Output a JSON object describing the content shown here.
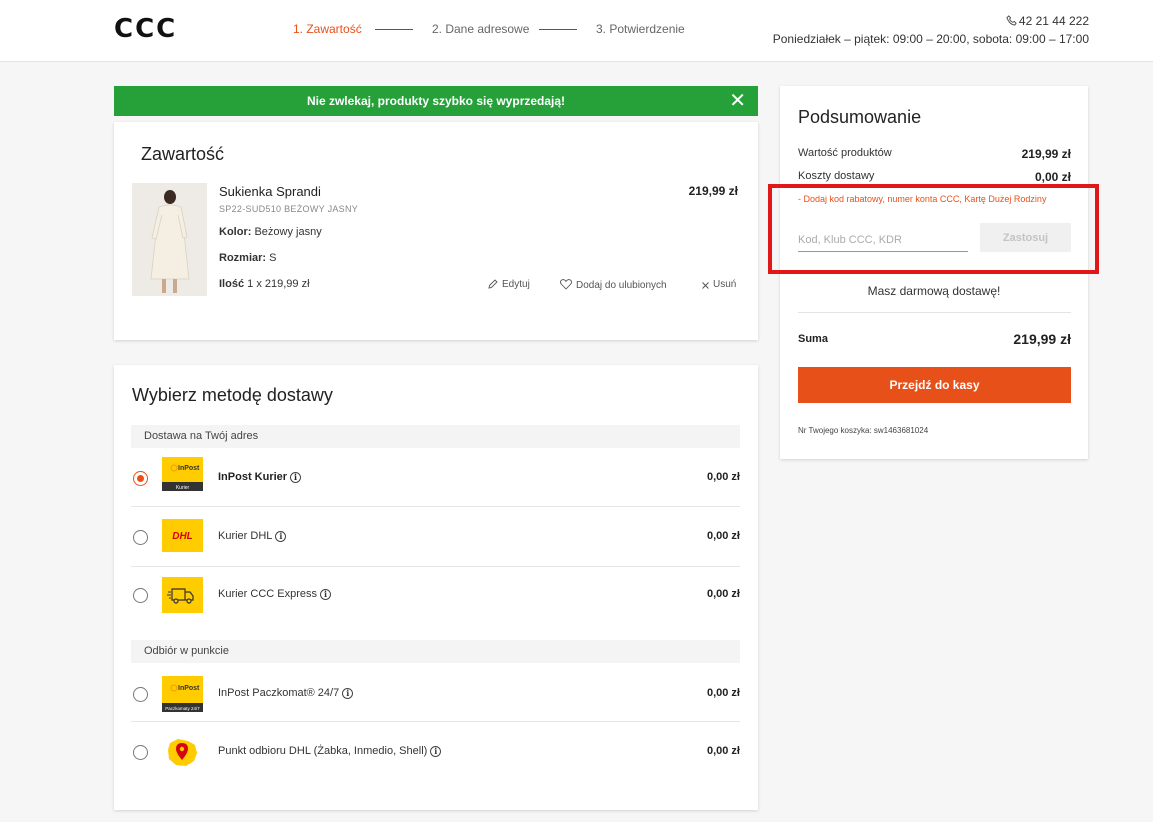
{
  "header": {
    "logo": "CCC",
    "steps": [
      {
        "label": "1. Zawartość",
        "active": true
      },
      {
        "label": "2. Dane adresowe",
        "active": false
      },
      {
        "label": "3. Potwierdzenie",
        "active": false
      }
    ],
    "phone": "42 21 44 222",
    "hours": "Poniedziałek – piątek: 09:00 – 20:00, sobota: 09:00 – 17:00"
  },
  "banner": {
    "text": "Nie zwlekaj, produkty szybko się wyprzedają!",
    "close": "✕",
    "color": "#26a13a"
  },
  "cart": {
    "title": "Zawartość",
    "product": {
      "name": "Sukienka Sprandi",
      "sku": "SP22-SUD510 BEŻOWY JASNY",
      "color_label": "Kolor:",
      "color_value": "Beżowy jasny",
      "size_label": "Rozmiar:",
      "size_value": "S",
      "qty_label": "Ilość",
      "qty_value": "1 x 219,99 zł",
      "price": "219,99 zł"
    },
    "actions": {
      "edit": "Edytuj",
      "favorite": "Dodaj do ulubionych",
      "remove": "Usuń"
    }
  },
  "delivery": {
    "title": "Wybierz metodę dostawy",
    "sections": [
      {
        "label": "Dostawa na Twój adres",
        "options": [
          {
            "name": "InPost Kurier",
            "price": "0,00 zł",
            "logo_text": "InPost",
            "logo_sub": "Kurier",
            "selected": true
          },
          {
            "name": "Kurier DHL",
            "price": "0,00 zł",
            "logo_text": "DHL",
            "selected": false
          },
          {
            "name": "Kurier CCC Express",
            "price": "0,00 zł",
            "logo_icon": "truck-icon",
            "selected": false
          }
        ]
      },
      {
        "label": "Odbiór w punkcie",
        "options": [
          {
            "name": "InPost Paczkomat® 24/7",
            "price": "0,00 zł",
            "logo_text": "InPost",
            "logo_sub": "Paczkomaty 24/7",
            "selected": false
          },
          {
            "name": "Punkt odbioru DHL (Żabka, Inmedio, Shell)",
            "price": "0,00 zł",
            "logo_icon": "map-pin-icon",
            "selected": false
          }
        ]
      }
    ]
  },
  "summary": {
    "title": "Podsumowanie",
    "products_label": "Wartość produktów",
    "products_value": "219,99 zł",
    "shipping_label": "Koszty dostawy",
    "shipping_value": "0,00 zł",
    "promo_hint": "- Dodaj kod rabatowy, numer konta CCC, Kartę Dużej Rodziny",
    "promo_placeholder": "Kod, Klub CCC, KDR",
    "apply_label": "Zastosuj",
    "free_shipping": "Masz darmową dostawę!",
    "total_label": "Suma",
    "total_value": "219,99 zł",
    "checkout_label": "Przejdź do kasy",
    "cart_number": "Nr Twojego koszyka: sw1463681024"
  },
  "colors": {
    "accent": "#e8501a",
    "highlight": "#e01818",
    "inpost_yellow": "#ffcc00"
  }
}
